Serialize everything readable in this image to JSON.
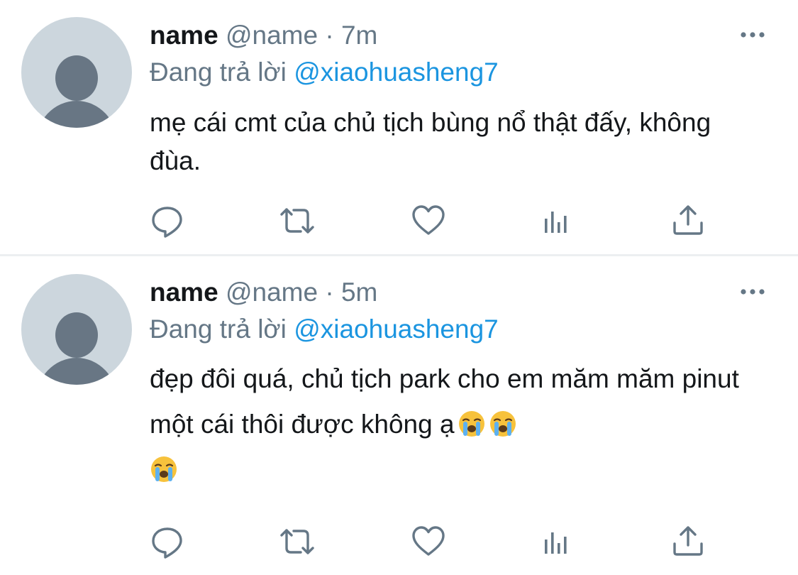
{
  "tweets": [
    {
      "name": "name",
      "handle": "@name",
      "dot": "·",
      "time": "7m",
      "replying_prefix": "Đang trả lời",
      "replying_to": "@xiaohuasheng7",
      "text": "mẹ cái cmt của chủ tịch bùng nổ thật đấy, không đùa."
    },
    {
      "name": "name",
      "handle": "@name",
      "dot": "·",
      "time": "5m",
      "replying_prefix": "Đang trả lời",
      "replying_to": "@xiaohuasheng7",
      "text": "đẹp đôi quá, chủ tịch park cho em măm măm pinut một cái thôi được không ạ",
      "emojis": [
        "loudly-crying-face",
        "loudly-crying-face",
        "loudly-crying-face"
      ]
    }
  ],
  "icons": {
    "reply": "reply-icon",
    "retweet": "retweet-icon",
    "like": "heart-icon",
    "analytics": "analytics-icon",
    "share": "share-icon",
    "more": "more-icon"
  },
  "colors": {
    "icon_gray": "#657786",
    "mention_blue": "#1b95e0",
    "avatar_bg": "#ccd6dd",
    "avatar_fg": "#657786"
  }
}
